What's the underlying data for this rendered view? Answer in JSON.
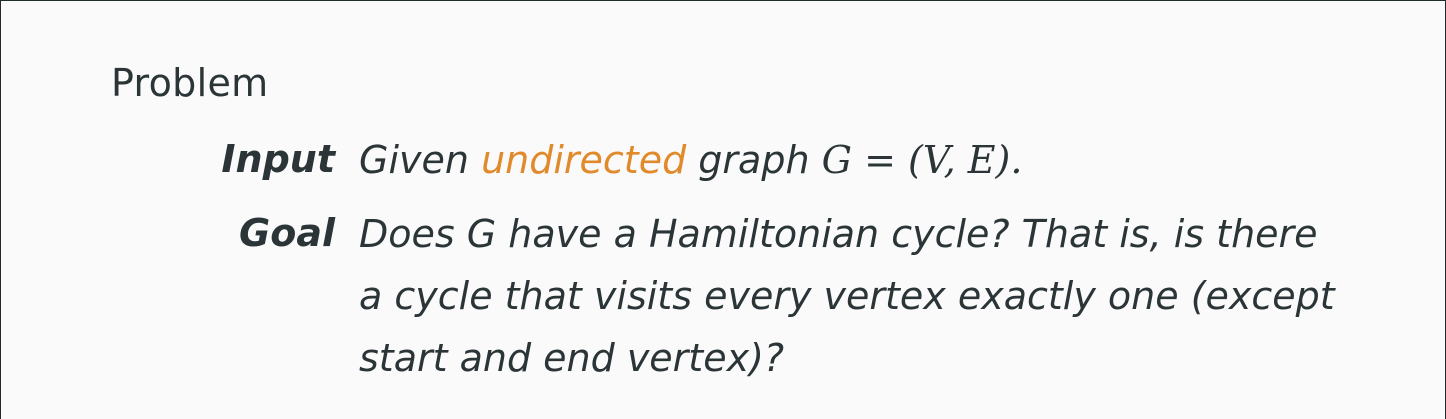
{
  "heading": "Problem",
  "input": {
    "label": "Input",
    "before": "Given",
    "highlight": "undirected",
    "after": "graph",
    "math": "G = (V, E).",
    "highlight_color": "#e08a2c"
  },
  "goal": {
    "label": "Goal",
    "text_lines": [
      "Does G have a Hamiltonian cycle? That is, is there",
      "a cycle that visits every vertex exactly one (except",
      "start and end vertex)?"
    ]
  }
}
